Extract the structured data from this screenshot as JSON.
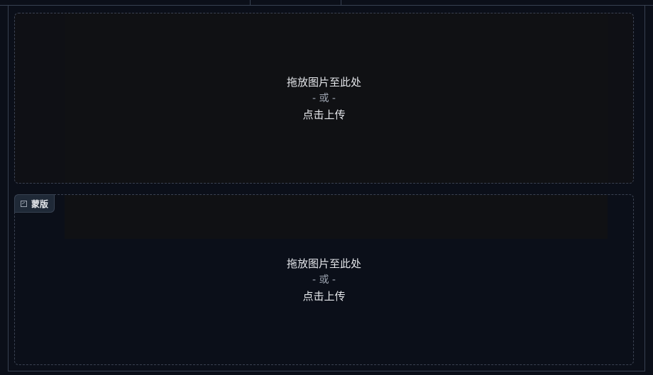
{
  "tabs": {
    "active_label": ""
  },
  "upload_primary": {
    "drop_text": "拖放图片至此处",
    "or_text": "- 或 -",
    "click_text": "点击上传"
  },
  "mask": {
    "label": "蒙版",
    "icon": "image-icon",
    "drop_text": "拖放图片至此处",
    "or_text": "- 或 -",
    "click_text": "点击上传"
  }
}
